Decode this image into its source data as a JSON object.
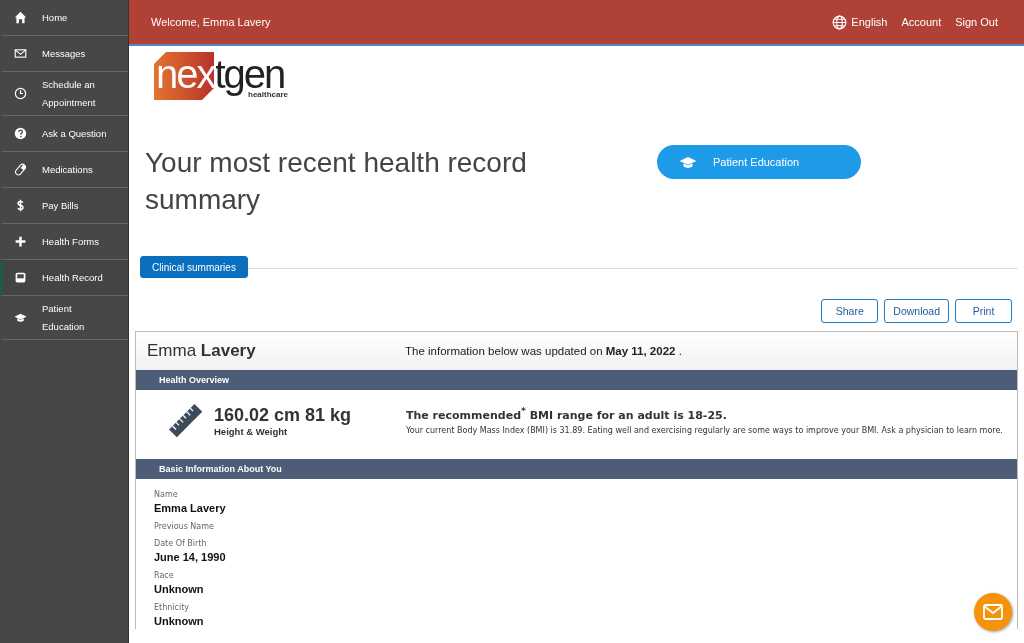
{
  "sidebar": {
    "items": [
      {
        "label": "Home",
        "selected": false
      },
      {
        "label": "Messages",
        "selected": false
      },
      {
        "label": "Schedule an Appointment",
        "selected": false
      },
      {
        "label": "Ask a Question",
        "selected": false
      },
      {
        "label": "Medications",
        "selected": false
      },
      {
        "label": "Pay Bills",
        "selected": false
      },
      {
        "label": "Health Forms",
        "selected": false
      },
      {
        "label": "Health Record",
        "selected": true
      },
      {
        "label": "Patient Education",
        "selected": false
      }
    ]
  },
  "top_bar": {
    "welcome": "Welcome, Emma Lavery",
    "language": "English",
    "links": [
      "Account",
      "Sign Out"
    ]
  },
  "logo": {
    "brand": "nextgen",
    "tagline": "healthcare"
  },
  "heading": "Your most recent health record summary",
  "education_button": "Patient Education",
  "tabs": [
    {
      "label": "Clinical summaries",
      "selected": true
    }
  ],
  "actions": [
    "Share",
    "Download",
    "Print"
  ],
  "record": {
    "patient_name": "Emma **Lavery**",
    "updated": "The information below was updated on **May 11, 2022** .",
    "overview_title": "Health Overview",
    "measurement": "160.02 cm 81 kg",
    "measurement_label": "Height & Weight",
    "bmi_headline": "The recommended$^{*}$ BMI range for an adult is 18-25.",
    "bmi_text": "Your current Body Mass Index (BMI) is 31.89. Eating well and exercising regularly are some ways to improve your BMI. Ask a physician to learn more.",
    "basic_title": "Basic Information About You",
    "fields": [
      {
        "label": "Name",
        "value": "Emma Lavery"
      },
      {
        "label": "Previous Name"
      },
      {
        "label": "Date Of Birth",
        "value": "June 14, 1990"
      },
      {
        "label": "Race",
        "value": "Unknown"
      },
      {
        "label": "Ethnicity",
        "value": "Unknown"
      }
    ]
  }
}
